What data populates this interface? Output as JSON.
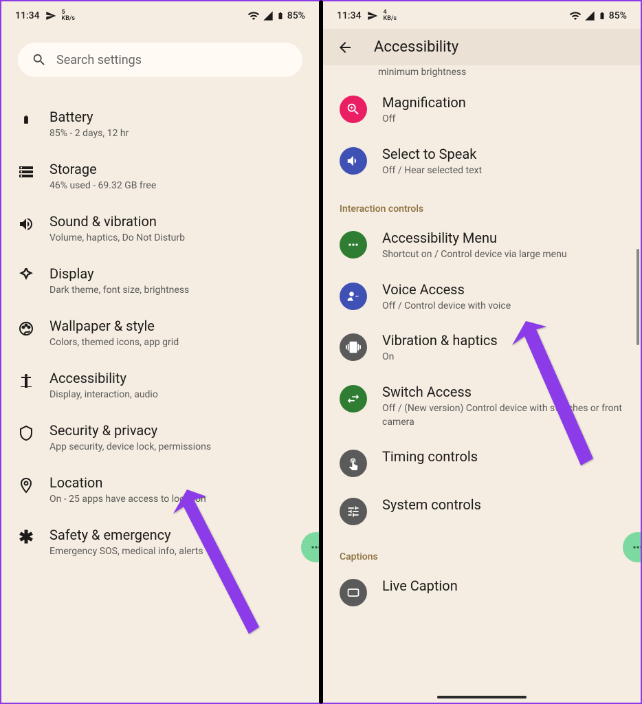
{
  "status": {
    "time": "11:34",
    "speed_left": "5",
    "speed_right": "4",
    "kbs": "KB/s",
    "battery": "85%"
  },
  "left": {
    "search_placeholder": "Search settings",
    "items": [
      {
        "title": "Battery",
        "sub": "85% - 2 days, 12 hr"
      },
      {
        "title": "Storage",
        "sub": "46% used - 69.32 GB free"
      },
      {
        "title": "Sound & vibration",
        "sub": "Volume, haptics, Do Not Disturb"
      },
      {
        "title": "Display",
        "sub": "Dark theme, font size, brightness"
      },
      {
        "title": "Wallpaper & style",
        "sub": "Colors, themed icons, app grid"
      },
      {
        "title": "Accessibility",
        "sub": "Display, interaction, audio"
      },
      {
        "title": "Security & privacy",
        "sub": "App security, device lock, permissions"
      },
      {
        "title": "Location",
        "sub": "On - 25 apps have access to location"
      },
      {
        "title": "Safety & emergency",
        "sub": "Emergency SOS, medical info, alerts"
      }
    ]
  },
  "right": {
    "header": "Accessibility",
    "truncated": "minimum brightness",
    "section_interaction": "Interaction controls",
    "section_captions": "Captions",
    "items_top": [
      {
        "title": "Magnification",
        "sub": "Off"
      },
      {
        "title": "Select to Speak",
        "sub": "Off / Hear selected text"
      }
    ],
    "items_interaction": [
      {
        "title": "Accessibility Menu",
        "sub": "Shortcut on / Control device via large menu"
      },
      {
        "title": "Voice Access",
        "sub": "Off / Control device with voice"
      },
      {
        "title": "Vibration & haptics",
        "sub": "On"
      },
      {
        "title": "Switch Access",
        "sub": "Off / (New version) Control device with switches or front camera"
      },
      {
        "title": "Timing controls",
        "sub": ""
      },
      {
        "title": "System controls",
        "sub": ""
      }
    ],
    "items_captions": [
      {
        "title": "Live Caption",
        "sub": ""
      }
    ]
  }
}
